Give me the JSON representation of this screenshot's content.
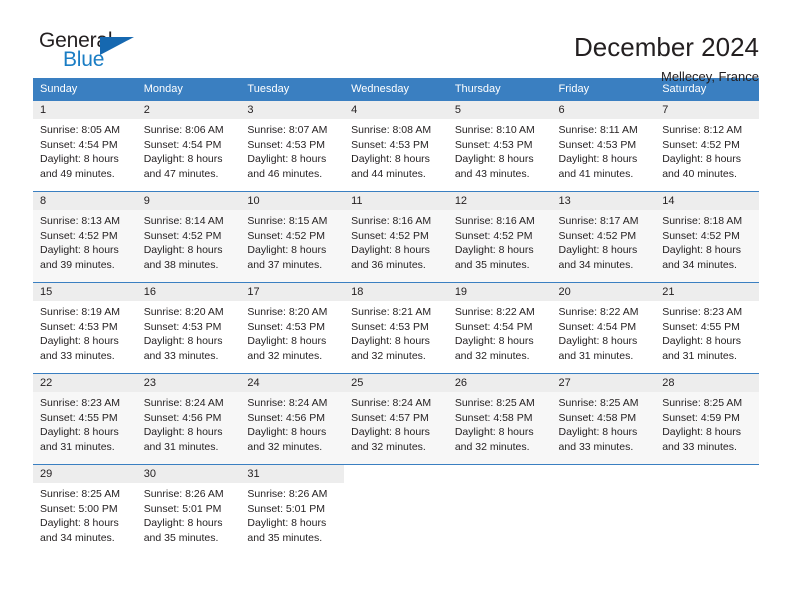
{
  "brand": {
    "name_top": "General",
    "name_bottom": "Blue",
    "mark": "triangle-logo-icon",
    "color_text": "#231f20",
    "color_blue": "#1a7dc4",
    "color_mark": "#1668b0"
  },
  "header": {
    "title": "December 2024",
    "subtitle": "Mellecey, France"
  },
  "theme": {
    "header_bg": "#3a7fc1",
    "header_text": "#ffffff",
    "daynum_bg": "#ededed",
    "row_shaded_bg": "#f7f7f7",
    "row_border": "#3a7fc1",
    "body_text": "#231f20"
  },
  "weekday_headers": [
    "Sunday",
    "Monday",
    "Tuesday",
    "Wednesday",
    "Thursday",
    "Friday",
    "Saturday"
  ],
  "weeks": [
    {
      "shaded": false,
      "days": [
        {
          "date": "1",
          "sunrise": "Sunrise: 8:05 AM",
          "sunset": "Sunset: 4:54 PM",
          "daylight_1": "Daylight: 8 hours",
          "daylight_2": "and 49 minutes."
        },
        {
          "date": "2",
          "sunrise": "Sunrise: 8:06 AM",
          "sunset": "Sunset: 4:54 PM",
          "daylight_1": "Daylight: 8 hours",
          "daylight_2": "and 47 minutes."
        },
        {
          "date": "3",
          "sunrise": "Sunrise: 8:07 AM",
          "sunset": "Sunset: 4:53 PM",
          "daylight_1": "Daylight: 8 hours",
          "daylight_2": "and 46 minutes."
        },
        {
          "date": "4",
          "sunrise": "Sunrise: 8:08 AM",
          "sunset": "Sunset: 4:53 PM",
          "daylight_1": "Daylight: 8 hours",
          "daylight_2": "and 44 minutes."
        },
        {
          "date": "5",
          "sunrise": "Sunrise: 8:10 AM",
          "sunset": "Sunset: 4:53 PM",
          "daylight_1": "Daylight: 8 hours",
          "daylight_2": "and 43 minutes."
        },
        {
          "date": "6",
          "sunrise": "Sunrise: 8:11 AM",
          "sunset": "Sunset: 4:53 PM",
          "daylight_1": "Daylight: 8 hours",
          "daylight_2": "and 41 minutes."
        },
        {
          "date": "7",
          "sunrise": "Sunrise: 8:12 AM",
          "sunset": "Sunset: 4:52 PM",
          "daylight_1": "Daylight: 8 hours",
          "daylight_2": "and 40 minutes."
        }
      ]
    },
    {
      "shaded": true,
      "days": [
        {
          "date": "8",
          "sunrise": "Sunrise: 8:13 AM",
          "sunset": "Sunset: 4:52 PM",
          "daylight_1": "Daylight: 8 hours",
          "daylight_2": "and 39 minutes."
        },
        {
          "date": "9",
          "sunrise": "Sunrise: 8:14 AM",
          "sunset": "Sunset: 4:52 PM",
          "daylight_1": "Daylight: 8 hours",
          "daylight_2": "and 38 minutes."
        },
        {
          "date": "10",
          "sunrise": "Sunrise: 8:15 AM",
          "sunset": "Sunset: 4:52 PM",
          "daylight_1": "Daylight: 8 hours",
          "daylight_2": "and 37 minutes."
        },
        {
          "date": "11",
          "sunrise": "Sunrise: 8:16 AM",
          "sunset": "Sunset: 4:52 PM",
          "daylight_1": "Daylight: 8 hours",
          "daylight_2": "and 36 minutes."
        },
        {
          "date": "12",
          "sunrise": "Sunrise: 8:16 AM",
          "sunset": "Sunset: 4:52 PM",
          "daylight_1": "Daylight: 8 hours",
          "daylight_2": "and 35 minutes."
        },
        {
          "date": "13",
          "sunrise": "Sunrise: 8:17 AM",
          "sunset": "Sunset: 4:52 PM",
          "daylight_1": "Daylight: 8 hours",
          "daylight_2": "and 34 minutes."
        },
        {
          "date": "14",
          "sunrise": "Sunrise: 8:18 AM",
          "sunset": "Sunset: 4:52 PM",
          "daylight_1": "Daylight: 8 hours",
          "daylight_2": "and 34 minutes."
        }
      ]
    },
    {
      "shaded": false,
      "days": [
        {
          "date": "15",
          "sunrise": "Sunrise: 8:19 AM",
          "sunset": "Sunset: 4:53 PM",
          "daylight_1": "Daylight: 8 hours",
          "daylight_2": "and 33 minutes."
        },
        {
          "date": "16",
          "sunrise": "Sunrise: 8:20 AM",
          "sunset": "Sunset: 4:53 PM",
          "daylight_1": "Daylight: 8 hours",
          "daylight_2": "and 33 minutes."
        },
        {
          "date": "17",
          "sunrise": "Sunrise: 8:20 AM",
          "sunset": "Sunset: 4:53 PM",
          "daylight_1": "Daylight: 8 hours",
          "daylight_2": "and 32 minutes."
        },
        {
          "date": "18",
          "sunrise": "Sunrise: 8:21 AM",
          "sunset": "Sunset: 4:53 PM",
          "daylight_1": "Daylight: 8 hours",
          "daylight_2": "and 32 minutes."
        },
        {
          "date": "19",
          "sunrise": "Sunrise: 8:22 AM",
          "sunset": "Sunset: 4:54 PM",
          "daylight_1": "Daylight: 8 hours",
          "daylight_2": "and 32 minutes."
        },
        {
          "date": "20",
          "sunrise": "Sunrise: 8:22 AM",
          "sunset": "Sunset: 4:54 PM",
          "daylight_1": "Daylight: 8 hours",
          "daylight_2": "and 31 minutes."
        },
        {
          "date": "21",
          "sunrise": "Sunrise: 8:23 AM",
          "sunset": "Sunset: 4:55 PM",
          "daylight_1": "Daylight: 8 hours",
          "daylight_2": "and 31 minutes."
        }
      ]
    },
    {
      "shaded": true,
      "days": [
        {
          "date": "22",
          "sunrise": "Sunrise: 8:23 AM",
          "sunset": "Sunset: 4:55 PM",
          "daylight_1": "Daylight: 8 hours",
          "daylight_2": "and 31 minutes."
        },
        {
          "date": "23",
          "sunrise": "Sunrise: 8:24 AM",
          "sunset": "Sunset: 4:56 PM",
          "daylight_1": "Daylight: 8 hours",
          "daylight_2": "and 31 minutes."
        },
        {
          "date": "24",
          "sunrise": "Sunrise: 8:24 AM",
          "sunset": "Sunset: 4:56 PM",
          "daylight_1": "Daylight: 8 hours",
          "daylight_2": "and 32 minutes."
        },
        {
          "date": "25",
          "sunrise": "Sunrise: 8:24 AM",
          "sunset": "Sunset: 4:57 PM",
          "daylight_1": "Daylight: 8 hours",
          "daylight_2": "and 32 minutes."
        },
        {
          "date": "26",
          "sunrise": "Sunrise: 8:25 AM",
          "sunset": "Sunset: 4:58 PM",
          "daylight_1": "Daylight: 8 hours",
          "daylight_2": "and 32 minutes."
        },
        {
          "date": "27",
          "sunrise": "Sunrise: 8:25 AM",
          "sunset": "Sunset: 4:58 PM",
          "daylight_1": "Daylight: 8 hours",
          "daylight_2": "and 33 minutes."
        },
        {
          "date": "28",
          "sunrise": "Sunrise: 8:25 AM",
          "sunset": "Sunset: 4:59 PM",
          "daylight_1": "Daylight: 8 hours",
          "daylight_2": "and 33 minutes."
        }
      ]
    },
    {
      "shaded": false,
      "days": [
        {
          "date": "29",
          "sunrise": "Sunrise: 8:25 AM",
          "sunset": "Sunset: 5:00 PM",
          "daylight_1": "Daylight: 8 hours",
          "daylight_2": "and 34 minutes."
        },
        {
          "date": "30",
          "sunrise": "Sunrise: 8:26 AM",
          "sunset": "Sunset: 5:01 PM",
          "daylight_1": "Daylight: 8 hours",
          "daylight_2": "and 35 minutes."
        },
        {
          "date": "31",
          "sunrise": "Sunrise: 8:26 AM",
          "sunset": "Sunset: 5:01 PM",
          "daylight_1": "Daylight: 8 hours",
          "daylight_2": "and 35 minutes."
        },
        {
          "date": "",
          "sunrise": "",
          "sunset": "",
          "daylight_1": "",
          "daylight_2": ""
        },
        {
          "date": "",
          "sunrise": "",
          "sunset": "",
          "daylight_1": "",
          "daylight_2": ""
        },
        {
          "date": "",
          "sunrise": "",
          "sunset": "",
          "daylight_1": "",
          "daylight_2": ""
        },
        {
          "date": "",
          "sunrise": "",
          "sunset": "",
          "daylight_1": "",
          "daylight_2": ""
        }
      ]
    }
  ]
}
